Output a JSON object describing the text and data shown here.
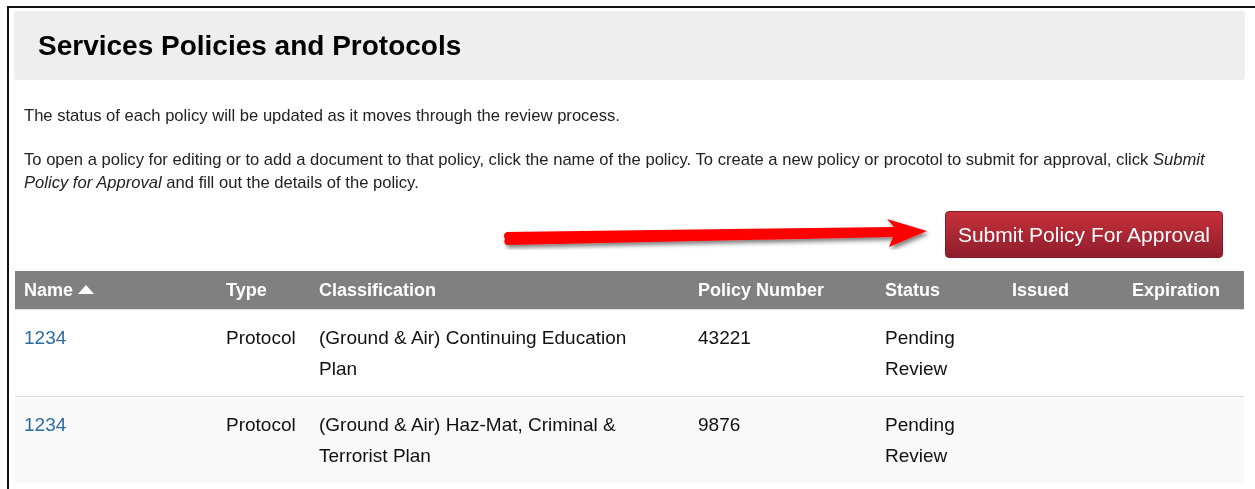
{
  "page_title": "Services Policies and Protocols",
  "paragraphs": [
    "The status of each policy will be updated as it moves through the review process.",
    "To open a policy for editing or to add a document to that policy, click the name of the policy. To create a new policy or procotol to submit for approval, click *Submit Policy for Approval* and fill out the details of the policy."
  ],
  "submit_button": "Submit Policy For Approval",
  "table": {
    "columns": [
      {
        "label": "Name",
        "sorted": true
      },
      {
        "label": "Type",
        "sorted": false
      },
      {
        "label": "Classification",
        "sorted": false
      },
      {
        "label": "Policy Number",
        "sorted": false
      },
      {
        "label": "Status",
        "sorted": false
      },
      {
        "label": "Issued",
        "sorted": false
      },
      {
        "label": "Expiration",
        "sorted": false
      }
    ],
    "rows": [
      {
        "name": "1234",
        "type": "Protocol",
        "classification": "(Ground & Air) Continuing Education Plan",
        "policy_number": "43221",
        "status": "Pending Review"
      },
      {
        "name": "1234",
        "type": "Protocol",
        "classification": "(Ground & Air) Haz-Mat, Criminal & Terrorist Plan",
        "policy_number": "9876",
        "status": "Pending Review"
      }
    ]
  }
}
